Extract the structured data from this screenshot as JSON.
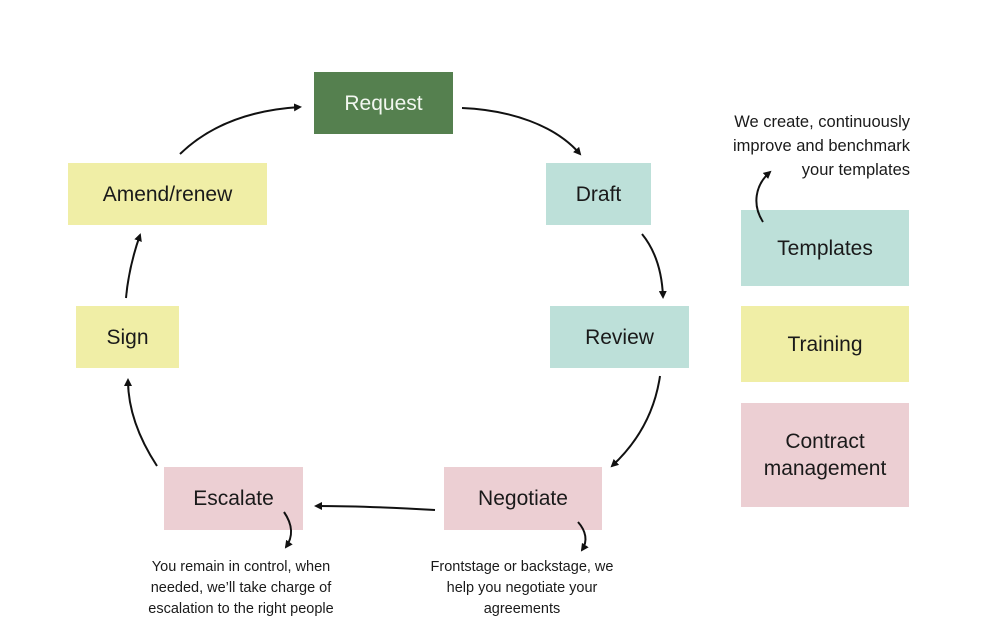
{
  "diagram": {
    "cycle": [
      {
        "id": "request",
        "label": "Request",
        "color": "#55804f"
      },
      {
        "id": "draft",
        "label": "Draft",
        "color": "#bde0d9"
      },
      {
        "id": "review",
        "label": "Review",
        "color": "#bde0d9"
      },
      {
        "id": "negotiate",
        "label": "Negotiate",
        "color": "#eccfd3"
      },
      {
        "id": "escalate",
        "label": "Escalate",
        "color": "#eccfd3"
      },
      {
        "id": "sign",
        "label": "Sign",
        "color": "#f0eea6"
      },
      {
        "id": "amend",
        "label": "Amend/renew",
        "color": "#f0eea6"
      }
    ],
    "services": [
      {
        "id": "templates",
        "label": "Templates",
        "color": "#bde0d9"
      },
      {
        "id": "training",
        "label": "Training",
        "color": "#f0eea6"
      },
      {
        "id": "contract",
        "label": "Contract management",
        "color": "#eccfd3"
      }
    ],
    "notes": {
      "templates": "We create, continuously improve and benchmark your templates",
      "escalate": "You remain in control, when needed, we’ll take charge of escalation to the right people",
      "negotiate": "Frontstage or backstage, we help you negotiate your agreements"
    }
  }
}
